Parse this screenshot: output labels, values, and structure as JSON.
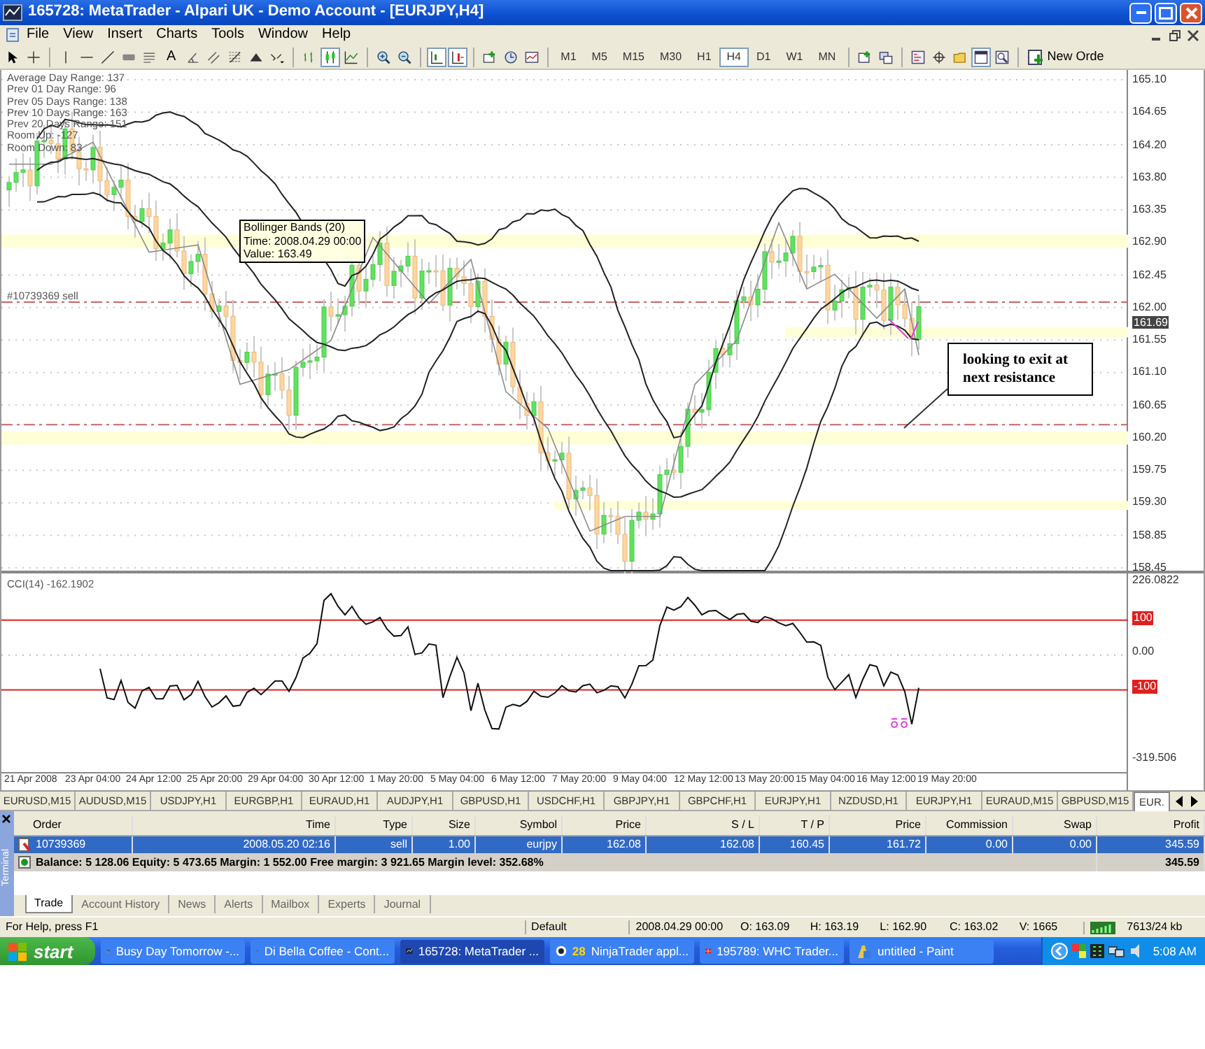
{
  "window": {
    "title": "165728: MetaTrader - Alpari UK - Demo Account - [EURJPY,H4]"
  },
  "menu": [
    "File",
    "View",
    "Insert",
    "Charts",
    "Tools",
    "Window",
    "Help"
  ],
  "toolbar": {
    "text_tool": "A",
    "chart_modes": [
      {
        "selected": false
      },
      {
        "selected": true
      },
      {
        "selected": false
      }
    ],
    "view_toggles": [
      {
        "on": true
      },
      {
        "on": true
      }
    ],
    "timeframes": [
      {
        "label": "M1",
        "selected": false
      },
      {
        "label": "M5",
        "selected": false
      },
      {
        "label": "M15",
        "selected": false
      },
      {
        "label": "M30",
        "selected": false
      },
      {
        "label": "H1",
        "selected": false
      },
      {
        "label": "H4",
        "selected": true
      },
      {
        "label": "D1",
        "selected": false
      },
      {
        "label": "W1",
        "selected": false
      },
      {
        "label": "MN",
        "selected": false
      }
    ],
    "new_order": "New Orde"
  },
  "chart": {
    "info_lines": [
      "Average Day Range: 137",
      "Prev 01 Day Range: 96",
      "Prev 05 Days Range: 138",
      "Prev 10 Days Range: 163",
      "Prev 20 Days Range: 151",
      "Room Up: -127",
      "Room Down: 83"
    ],
    "tooltip": [
      "Bollinger Bands (20)",
      "Time: 2008.04.29 00:00",
      "Value: 163.49"
    ],
    "order_label": "#10739369 sell",
    "note": "looking to exit at next resistance",
    "price_axis": [
      "165.10",
      "164.65",
      "164.20",
      "163.80",
      "163.35",
      "162.90",
      "162.45",
      "162.00",
      "161.55",
      "161.10",
      "160.65",
      "160.20",
      "159.75",
      "159.30",
      "158.85",
      "158.45"
    ],
    "current_price": "161.69"
  },
  "indicator": {
    "label": "CCI(14) -162.1902",
    "axis": [
      {
        "label": "226.0822",
        "kind": "plain"
      },
      {
        "label": "100",
        "kind": "level"
      },
      {
        "label": "0.00",
        "kind": "plain"
      },
      {
        "label": "-100",
        "kind": "level"
      },
      {
        "label": "-319.506",
        "kind": "plain"
      }
    ]
  },
  "time_axis": [
    "21 Apr 2008",
    "23 Apr 04:00",
    "24 Apr 12:00",
    "25 Apr 20:00",
    "29 Apr 04:00",
    "30 Apr 12:00",
    "1 May 20:00",
    "5 May 04:00",
    "6 May 12:00",
    "7 May 20:00",
    "9 May 04:00",
    "12 May 12:00",
    "13 May 20:00",
    "15 May 04:00",
    "16 May 12:00",
    "19 May 20:00"
  ],
  "symbol_tabs": [
    {
      "label": "EURUSD,M15",
      "selected": false
    },
    {
      "label": "AUDUSD,M15",
      "selected": false
    },
    {
      "label": "USDJPY,H1",
      "selected": false
    },
    {
      "label": "EURGBP,H1",
      "selected": false
    },
    {
      "label": "EURAUD,H1",
      "selected": false
    },
    {
      "label": "AUDJPY,H1",
      "selected": false
    },
    {
      "label": "GBPUSD,H1",
      "selected": false
    },
    {
      "label": "USDCHF,H1",
      "selected": false
    },
    {
      "label": "GBPJPY,H1",
      "selected": false
    },
    {
      "label": "GBPCHF,H1",
      "selected": false
    },
    {
      "label": "EURJPY,H1",
      "selected": false
    },
    {
      "label": "NZDUSD,H1",
      "selected": false
    },
    {
      "label": "EURJPY,H1",
      "selected": false
    },
    {
      "label": "EURAUD,M15",
      "selected": false
    },
    {
      "label": "GBPUSD,M15",
      "selected": false
    },
    {
      "label": "EUR.",
      "selected": true
    }
  ],
  "terminal": {
    "side_label": "Terminal",
    "columns": [
      "Order",
      "Time",
      "Type",
      "Size",
      "Symbol",
      "Price",
      "S / L",
      "T / P",
      "Price",
      "Commission",
      "Swap",
      "Profit"
    ],
    "rows": [
      {
        "cells": [
          "10739369",
          "2008.05.20 02:16",
          "sell",
          "1.00",
          "eurjpy",
          "162.08",
          "162.08",
          "160.45",
          "161.72",
          "0.00",
          "0.00",
          "345.59"
        ],
        "selected": true
      }
    ],
    "summary": {
      "text": "Balance: 5 128.06  Equity: 5 473.65  Margin: 1 552.00  Free margin: 3 921.65  Margin level: 352.68%",
      "total": "345.59"
    },
    "tabs": [
      {
        "label": "Trade",
        "selected": true
      },
      {
        "label": "Account History",
        "selected": false
      },
      {
        "label": "News",
        "selected": false
      },
      {
        "label": "Alerts",
        "selected": false
      },
      {
        "label": "Mailbox",
        "selected": false
      },
      {
        "label": "Experts",
        "selected": false
      },
      {
        "label": "Journal",
        "selected": false
      }
    ]
  },
  "status_bar": {
    "help": "For Help, press F1",
    "profile": "Default",
    "time": "2008.04.29 00:00",
    "open": "O: 163.09",
    "high": "H: 163.19",
    "low": "L: 162.90",
    "close": "C: 163.02",
    "volume": "V: 1665",
    "traffic": "7613/24 kb"
  },
  "taskbar": {
    "start": "start",
    "items": [
      {
        "label": "Busy Day Tomorrow -...",
        "kind": "browser",
        "selected": false
      },
      {
        "label": "Di Bella Coffee - Cont...",
        "kind": "browser",
        "selected": false
      },
      {
        "label": "165728: MetaTrader ...",
        "kind": "trading",
        "selected": true
      },
      {
        "count": "28",
        "label": "NinjaTrader appl...",
        "kind": "ninja",
        "selected": false
      },
      {
        "label": "195789: WHC Trader...",
        "kind": "broker",
        "selected": false
      },
      {
        "label": "untitled - Paint",
        "kind": "paint",
        "selected": false
      }
    ],
    "clock": "5:08 AM"
  }
}
